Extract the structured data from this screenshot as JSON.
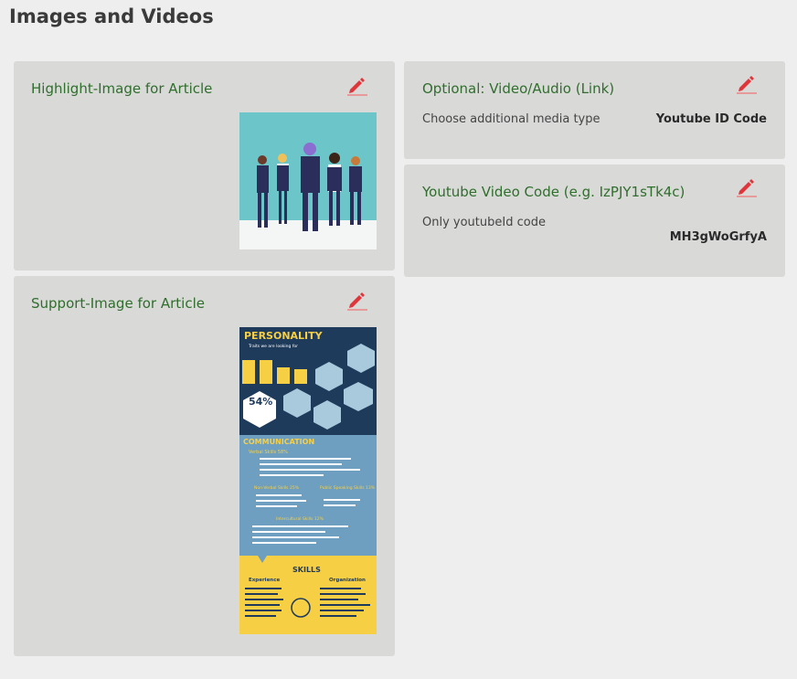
{
  "page": {
    "title": "Images and Videos"
  },
  "highlight_card": {
    "title": "Highlight-Image for Article",
    "edit_icon": "pencil-icon"
  },
  "support_card": {
    "title": "Support-Image for Article",
    "edit_icon": "pencil-icon",
    "infographic": {
      "heading": "PERSONALITY",
      "subheading": "Traits we are looking for",
      "stat": "54%",
      "section_communication": "COMMUNICATION",
      "verbal": "Verbal Skills 58%",
      "nonverbal": "Non-Verbal Skills 25%",
      "public": "Public Speaking Skills 13%",
      "intercultural": "Intercultural Skills 12%",
      "skills": "SKILLS",
      "experience": "Experience",
      "organization": "Organization"
    }
  },
  "video_card": {
    "title": "Optional: Video/Audio (Link)",
    "label": "Choose additional media type",
    "value": "Youtube ID Code",
    "edit_icon": "pencil-icon"
  },
  "youtube_card": {
    "title": "Youtube Video Code (e.g. IzPJY1sTk4c)",
    "label": "Only youtubeId code",
    "value": "MH3gWoGrfyA",
    "edit_icon": "pencil-icon"
  },
  "colors": {
    "card_bg": "#d9dad8",
    "title_green": "#2f6e2c",
    "edit_red": "#e0353a"
  }
}
